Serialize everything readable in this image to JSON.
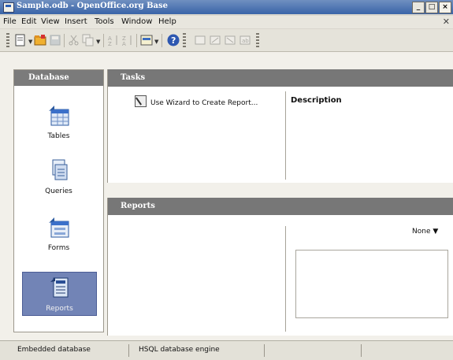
{
  "window": {
    "title": "Sample.odb - OpenOffice.org Base"
  },
  "menu": [
    "File",
    "Edit",
    "View",
    "Insert",
    "Tools",
    "Window",
    "Help"
  ],
  "left_panel": {
    "header": "Database",
    "items": [
      {
        "label": "Tables",
        "icon": "table-icon",
        "selected": false
      },
      {
        "label": "Queries",
        "icon": "query-icon",
        "selected": false
      },
      {
        "label": "Forms",
        "icon": "form-icon",
        "selected": false
      },
      {
        "label": "Reports",
        "icon": "report-icon",
        "selected": true
      }
    ]
  },
  "tasks": {
    "header": "Tasks",
    "items": [
      "Use Wizard to Create Report..."
    ],
    "description_label": "Description"
  },
  "reports": {
    "header": "Reports",
    "preview_mode": "None"
  },
  "status": {
    "left": "Embedded database",
    "engine": "HSQL database engine"
  },
  "colors": {
    "selection": "#7284b6",
    "header_bar": "#777777",
    "title_bar": "#3a64a8"
  }
}
